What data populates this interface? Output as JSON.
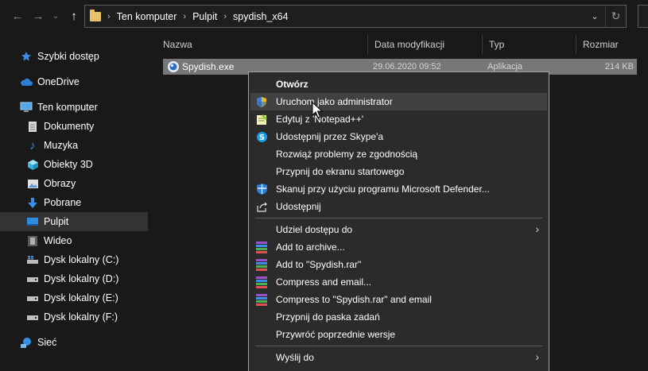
{
  "toolbar": {
    "back_icon": "arrow-left-icon",
    "forward_icon": "arrow-right-icon",
    "recent_icon": "chevron-down-icon",
    "up_icon": "arrow-up-icon",
    "breadcrumbs": [
      "Ten komputer",
      "Pulpit",
      "spydish_x64"
    ],
    "refresh_icon": "refresh-icon"
  },
  "sidebar": {
    "items": [
      {
        "label": "Szybki dostęp",
        "icon": "star-icon"
      },
      {
        "label": "OneDrive",
        "icon": "cloud-icon"
      },
      {
        "label": "Ten komputer",
        "icon": "computer-icon"
      },
      {
        "label": "Dokumenty",
        "icon": "document-icon"
      },
      {
        "label": "Muzyka",
        "icon": "music-note-icon"
      },
      {
        "label": "Obiekty 3D",
        "icon": "cube-icon"
      },
      {
        "label": "Obrazy",
        "icon": "picture-icon"
      },
      {
        "label": "Pobrane",
        "icon": "download-arrow-icon"
      },
      {
        "label": "Pulpit",
        "icon": "desktop-icon"
      },
      {
        "label": "Wideo",
        "icon": "film-icon"
      },
      {
        "label": "Dysk lokalny (C:)",
        "icon": "windows-drive-icon"
      },
      {
        "label": "Dysk lokalny (D:)",
        "icon": "drive-icon"
      },
      {
        "label": "Dysk lokalny (E:)",
        "icon": "drive-icon"
      },
      {
        "label": "Dysk lokalny (F:)",
        "icon": "drive-icon"
      },
      {
        "label": "Sieć",
        "icon": "network-icon"
      }
    ]
  },
  "filelist": {
    "columns": [
      "Nazwa",
      "Data modyfikacji",
      "Typ",
      "Rozmiar"
    ],
    "rows": [
      {
        "name": "Spydish.exe",
        "modified": "29.06.2020 09:52",
        "type": "Aplikacja",
        "size": "214 KB"
      }
    ]
  },
  "context_menu": {
    "items": [
      {
        "label": "Otwórz",
        "icon": ""
      },
      {
        "label": "Uruchom jako administrator",
        "icon": "uac-shield-icon"
      },
      {
        "label": "Edytuj z 'Notepad++'",
        "icon": "notepadplusplus-icon"
      },
      {
        "label": "Udostępnij przez Skype'a",
        "icon": "skype-icon"
      },
      {
        "label": "Rozwiąż problemy ze zgodnością",
        "icon": ""
      },
      {
        "label": "Przypnij do ekranu startowego",
        "icon": ""
      },
      {
        "label": "Skanuj przy użyciu programu Microsoft Defender...",
        "icon": "defender-shield-icon"
      },
      {
        "label": "Udostępnij",
        "icon": "share-icon"
      },
      {
        "label": "Udziel dostępu do",
        "icon": ""
      },
      {
        "label": "Add to archive...",
        "icon": "winrar-icon"
      },
      {
        "label": "Add to \"Spydish.rar\"",
        "icon": "winrar-icon"
      },
      {
        "label": "Compress and email...",
        "icon": "winrar-icon"
      },
      {
        "label": "Compress to \"Spydish.rar\" and email",
        "icon": "winrar-icon"
      },
      {
        "label": "Przypnij do paska zadań",
        "icon": ""
      },
      {
        "label": "Przywróć poprzednie wersje",
        "icon": ""
      },
      {
        "label": "Wyślij do",
        "icon": ""
      }
    ]
  },
  "colors": {
    "background": "#191919",
    "menu_background": "#2b2b2b",
    "selection": "#777777",
    "folder_yellow": "#e8c26a",
    "accent_blue": "#3a8ee6"
  }
}
